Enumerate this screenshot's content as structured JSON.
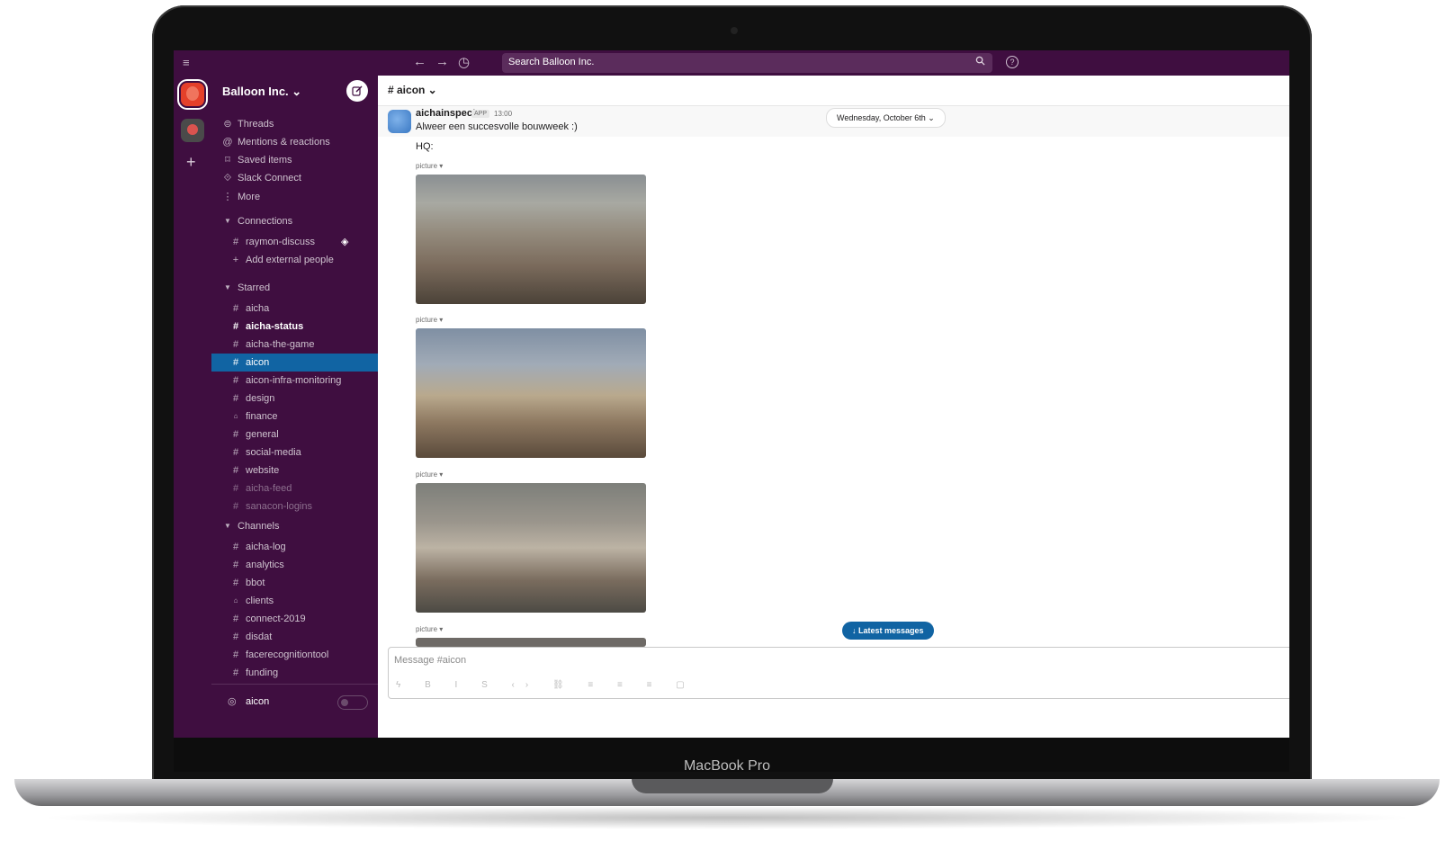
{
  "device": {
    "label": "MacBook Pro"
  },
  "topbar": {
    "search_placeholder": "Search Balloon Inc.",
    "back": "←",
    "forward": "→",
    "history": "◷",
    "help": "?"
  },
  "workspace": {
    "name": "Balloon Inc. ⌄"
  },
  "nav": [
    {
      "icon": "⊜",
      "label": "Threads"
    },
    {
      "icon": "@",
      "label": "Mentions & reactions"
    },
    {
      "icon": "⌑",
      "label": "Saved items"
    },
    {
      "icon": "⟐",
      "label": "Slack Connect"
    },
    {
      "icon": "⋮",
      "label": "More"
    }
  ],
  "sections": {
    "connections": "Connections",
    "starred": "Starred",
    "channels": "Channels"
  },
  "connections": [
    {
      "icon": "#",
      "label": "raymon-discuss"
    },
    {
      "icon": "+",
      "label": "Add external people"
    }
  ],
  "starred": [
    {
      "icon": "#",
      "label": "aicha"
    },
    {
      "icon": "#",
      "label": "aicha-status"
    },
    {
      "icon": "#",
      "label": "aicha-the-game"
    },
    {
      "icon": "#",
      "label": "aicon"
    },
    {
      "icon": "#",
      "label": "aicon-infra-monitoring"
    },
    {
      "icon": "#",
      "label": "design"
    },
    {
      "icon": "🔒",
      "label": "finance"
    },
    {
      "icon": "#",
      "label": "general"
    },
    {
      "icon": "#",
      "label": "social-media"
    },
    {
      "icon": "#",
      "label": "website"
    },
    {
      "icon": "#",
      "label": "aicha-feed"
    },
    {
      "icon": "#",
      "label": "sanacon-logins"
    }
  ],
  "channels": [
    {
      "icon": "#",
      "label": "aicha-log"
    },
    {
      "icon": "#",
      "label": "analytics"
    },
    {
      "icon": "#",
      "label": "bbot"
    },
    {
      "icon": "🔒",
      "label": "clients"
    },
    {
      "icon": "#",
      "label": "connect-2019"
    },
    {
      "icon": "#",
      "label": "disdat"
    },
    {
      "icon": "#",
      "label": "facerecognitiontool"
    },
    {
      "icon": "#",
      "label": "funding"
    }
  ],
  "huddle": {
    "label": "aicon"
  },
  "channel": {
    "title": "# aicon ⌄"
  },
  "message": {
    "sender": "aichainspect",
    "badge": "APP",
    "time": "13:00",
    "text": "Alweer een succesvolle bouwweek :)",
    "hq": "HQ:",
    "attachment_label": "picture ▾"
  },
  "date_divider": "Wednesday, October 6th ⌄",
  "latest_button": "↓  Latest messages",
  "composer": {
    "placeholder": "Message #aicon",
    "tools": "ϟ B I S ‹› ⛓ ≡ ≡ ≡ ▢"
  },
  "colors": {
    "sidebar": "#3f0e40",
    "active": "#1164a3"
  }
}
